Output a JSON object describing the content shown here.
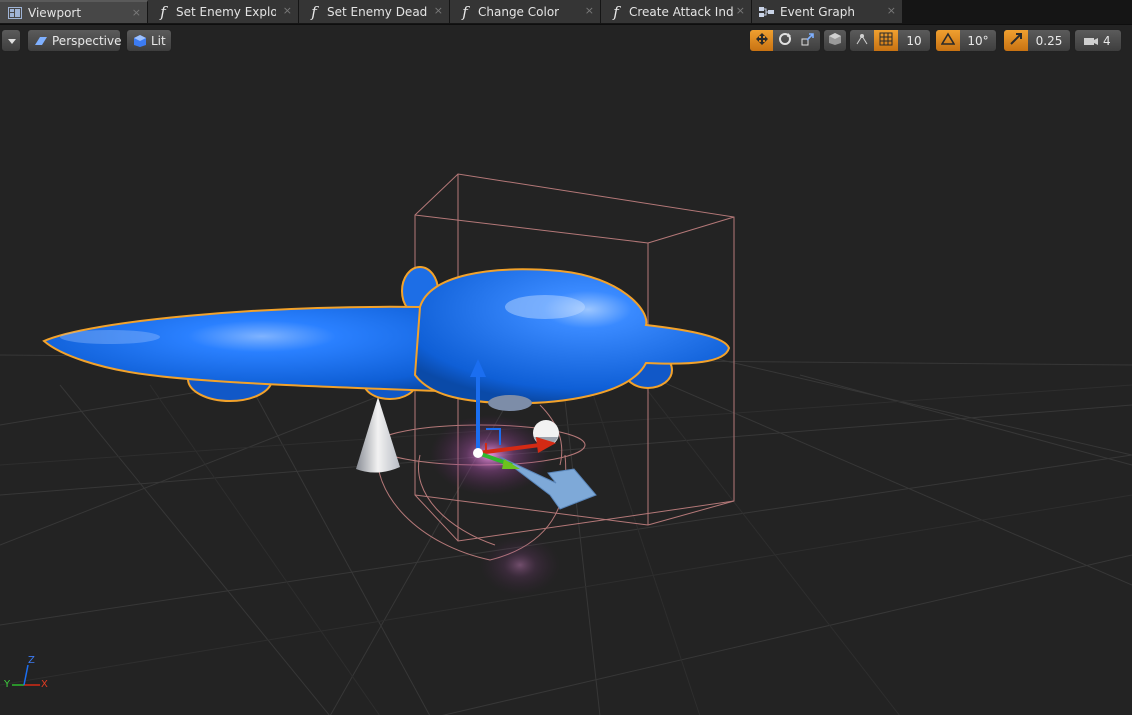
{
  "tabs": [
    {
      "label": "Viewport",
      "icon": "viewport-icon",
      "close": "×"
    },
    {
      "label": "Set Enemy Explode",
      "icon": "function-icon",
      "close": "×"
    },
    {
      "label": "Set Enemy Dead",
      "icon": "function-icon",
      "close": "×"
    },
    {
      "label": "Change Color",
      "icon": "function-icon",
      "close": "×"
    },
    {
      "label": "Create Attack Indic",
      "icon": "function-icon",
      "close": "×"
    },
    {
      "label": "Event Graph",
      "icon": "event-graph-icon",
      "close": "×"
    }
  ],
  "function_glyph": "f",
  "toolbar": {
    "view_mode": "Perspective",
    "lighting": "Lit",
    "grid_snap": "10",
    "rotation_snap": "10°",
    "scale_snap": "0.25",
    "camera_speed": "4"
  },
  "axis_gizmo": {
    "z": "Z",
    "y": "Y",
    "x": "X"
  },
  "colors": {
    "accent": "#e8901f",
    "mesh_blue": "#1866d8",
    "selection_outline": "#f2a22b",
    "bounds_box": "#b47878",
    "grid": "#3a3a3a"
  }
}
